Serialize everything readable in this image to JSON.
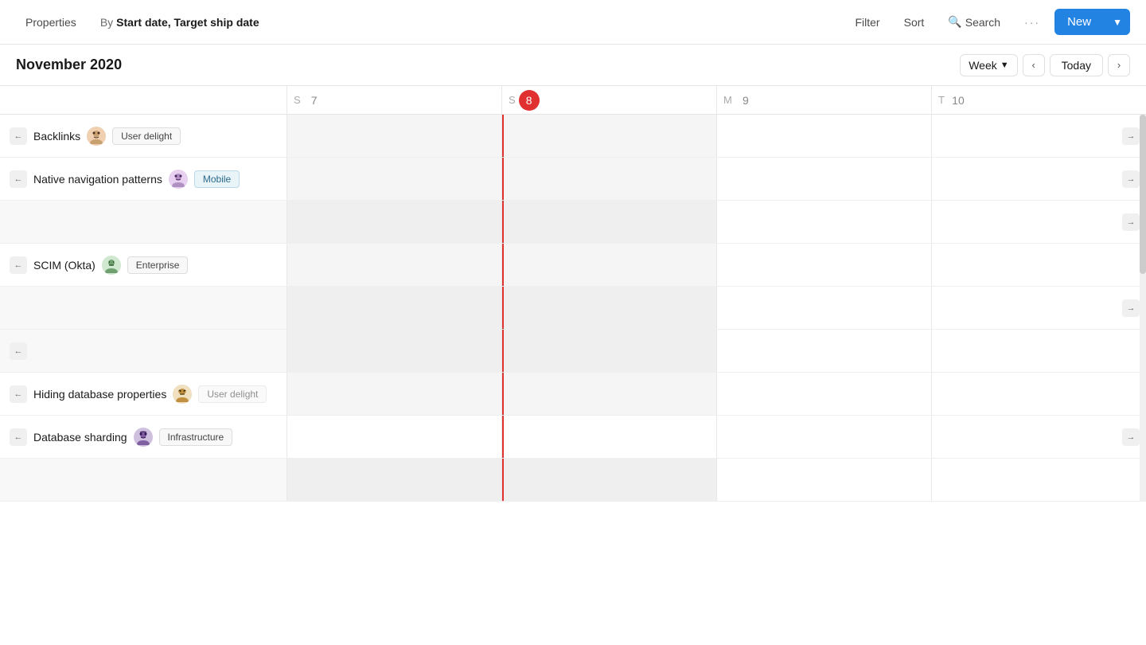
{
  "toolbar": {
    "properties_label": "Properties",
    "by_label": "By",
    "by_value": "Start date, Target ship date",
    "filter_label": "Filter",
    "sort_label": "Sort",
    "search_label": "Search",
    "more_label": "···",
    "new_label": "New"
  },
  "calendar": {
    "month_year": "November 2020",
    "week_label": "Week",
    "today_label": "Today",
    "days": [
      {
        "letter": "S",
        "number": "7",
        "today": false
      },
      {
        "letter": "S",
        "number": "8",
        "today": true
      },
      {
        "letter": "M",
        "number": "9",
        "today": false
      },
      {
        "letter": "T",
        "number": "10",
        "today": false
      }
    ]
  },
  "rows": [
    {
      "id": "backlinks",
      "label": "Backlinks",
      "avatar": "😊",
      "tag": "User delight",
      "tag_style": "default",
      "has_left_arrow": true,
      "has_right_arrow": true
    },
    {
      "id": "native-nav",
      "label": "Native navigation patterns",
      "avatar": "🤖",
      "tag": "Mobile",
      "tag_style": "blue",
      "has_left_arrow": true,
      "has_right_arrow": true
    },
    {
      "id": "scim",
      "label": "SCIM (Okta)",
      "avatar": "😐",
      "tag": "Enterprise",
      "tag_style": "default",
      "has_left_arrow": true,
      "has_right_arrow": false
    },
    {
      "id": "hiding",
      "label": "Hiding database properties",
      "avatar": "🤔",
      "tag": "User delight",
      "tag_style": "default",
      "has_left_arrow": true,
      "has_right_arrow": false
    },
    {
      "id": "sharding",
      "label": "Database sharding",
      "avatar": "👩",
      "tag": "Infrastructure",
      "tag_style": "default",
      "has_left_arrow": true,
      "has_right_arrow": true
    }
  ]
}
